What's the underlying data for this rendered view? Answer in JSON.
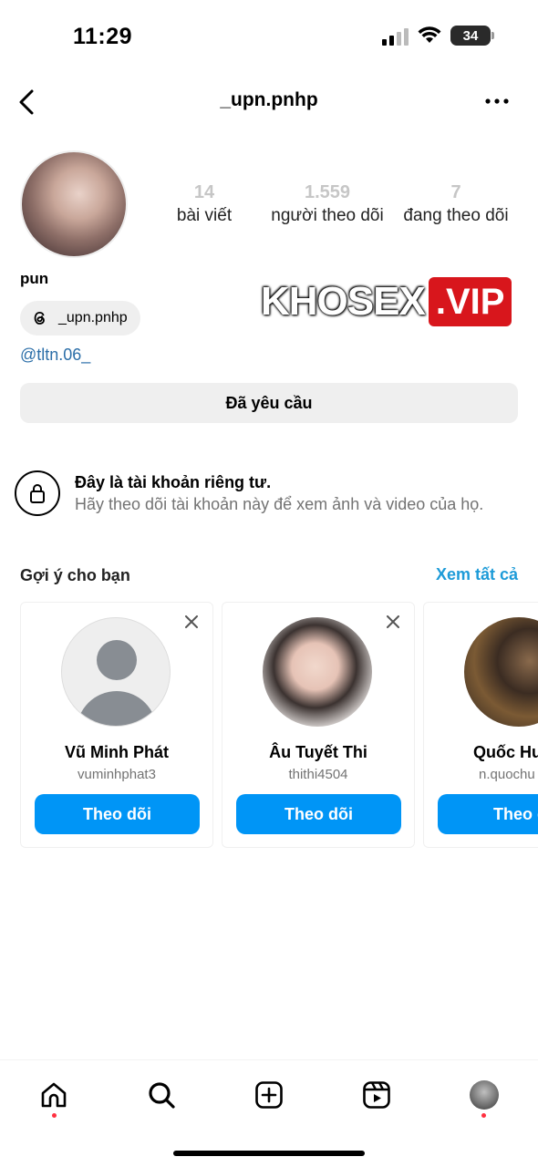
{
  "status_bar": {
    "time": "11:29",
    "battery": "34"
  },
  "header": {
    "username": "_upn.pnhp",
    "back_icon": "chevron-left-icon",
    "more_icon": "more-horizontal-icon"
  },
  "profile": {
    "stats": [
      {
        "value": "14",
        "label": "bài viết"
      },
      {
        "value": "1.559",
        "label": "người theo dõi"
      },
      {
        "value": "7",
        "label": "đang theo dõi"
      }
    ],
    "display_name": "pun",
    "threads_handle": "_upn.pnhp",
    "bio_link": "@tltn.06_",
    "requested_label": "Đã yêu cầu"
  },
  "watermark": {
    "text": "KHOSEX",
    "badge": ".VIP"
  },
  "private_notice": {
    "title": "Đây là tài khoản riêng tư.",
    "description": "Hãy theo dõi tài khoản này để xem ảnh và video của họ."
  },
  "suggestions": {
    "title": "Gợi ý cho bạn",
    "see_all": "Xem tất cả",
    "cards": [
      {
        "name": "Vũ Minh Phát",
        "username": "vuminhphat3",
        "button": "Theo dõi"
      },
      {
        "name": "Âu Tuyết Thi",
        "username": "thithi4504",
        "button": "Theo dõi"
      },
      {
        "name": "Quốc Hu",
        "username": "n.quochu",
        "button": "Theo d"
      }
    ]
  },
  "tab_bar": {
    "tabs": [
      "home-icon",
      "search-icon",
      "create-icon",
      "reels-icon",
      "profile-avatar"
    ],
    "accent": "#0095f6",
    "notification_color": "#ff3040"
  }
}
